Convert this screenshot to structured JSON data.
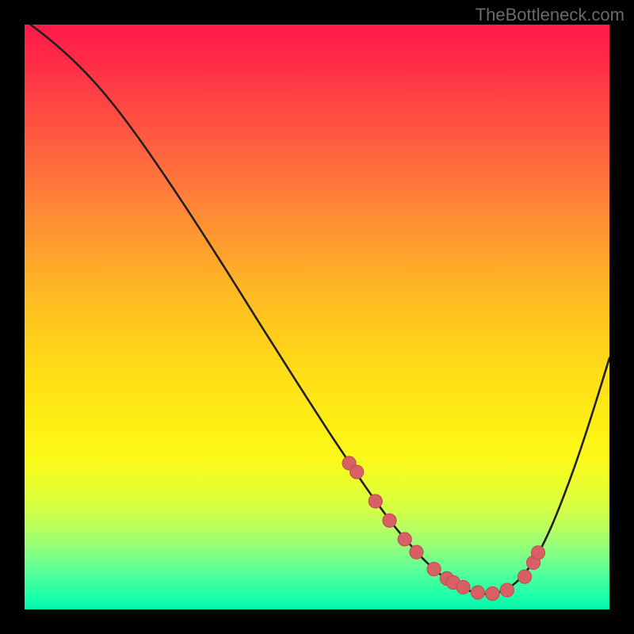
{
  "watermark": "TheBottleneck.com",
  "colors": {
    "frame": "#000000",
    "curve": "#221f1f",
    "marker_fill": "#d85f63",
    "marker_stroke": "#c24b4f"
  },
  "chart_data": {
    "type": "line",
    "title": "",
    "xlabel": "",
    "ylabel": "",
    "xlim": [
      0,
      100
    ],
    "ylim": [
      0,
      100
    ],
    "grid": false,
    "series": [
      {
        "name": "bottleneck-curve",
        "x": [
          1,
          4,
          8,
          12,
          16,
          20,
          24,
          28,
          32,
          36,
          40,
          44,
          48,
          52,
          55,
          58,
          61,
          63.5,
          66,
          68,
          70,
          72,
          74,
          76,
          78,
          80,
          82,
          84,
          86,
          88,
          90,
          92,
          94,
          96,
          98,
          100
        ],
        "y": [
          100,
          97.7,
          94.2,
          90.1,
          85.3,
          79.9,
          74.1,
          68.1,
          61.9,
          55.6,
          49.2,
          42.9,
          36.6,
          30.4,
          25.9,
          21.4,
          17.2,
          13.9,
          11.0,
          8.8,
          6.9,
          5.3,
          4.1,
          3.2,
          2.7,
          2.7,
          3.3,
          4.6,
          6.8,
          9.9,
          14.0,
          18.9,
          24.3,
          30.2,
          36.5,
          43.0
        ]
      }
    ],
    "markers": {
      "name": "highlight-points",
      "x": [
        55.5,
        56.8,
        60.0,
        62.4,
        65.0,
        67.0,
        70.0,
        72.2,
        73.3,
        75.0,
        77.5,
        80.0,
        82.5,
        85.5,
        87.0,
        87.8
      ],
      "y": [
        25.0,
        23.5,
        18.5,
        15.2,
        12.0,
        9.8,
        6.9,
        5.3,
        4.6,
        3.8,
        2.9,
        2.7,
        3.3,
        5.6,
        8.0,
        9.7
      ]
    }
  }
}
